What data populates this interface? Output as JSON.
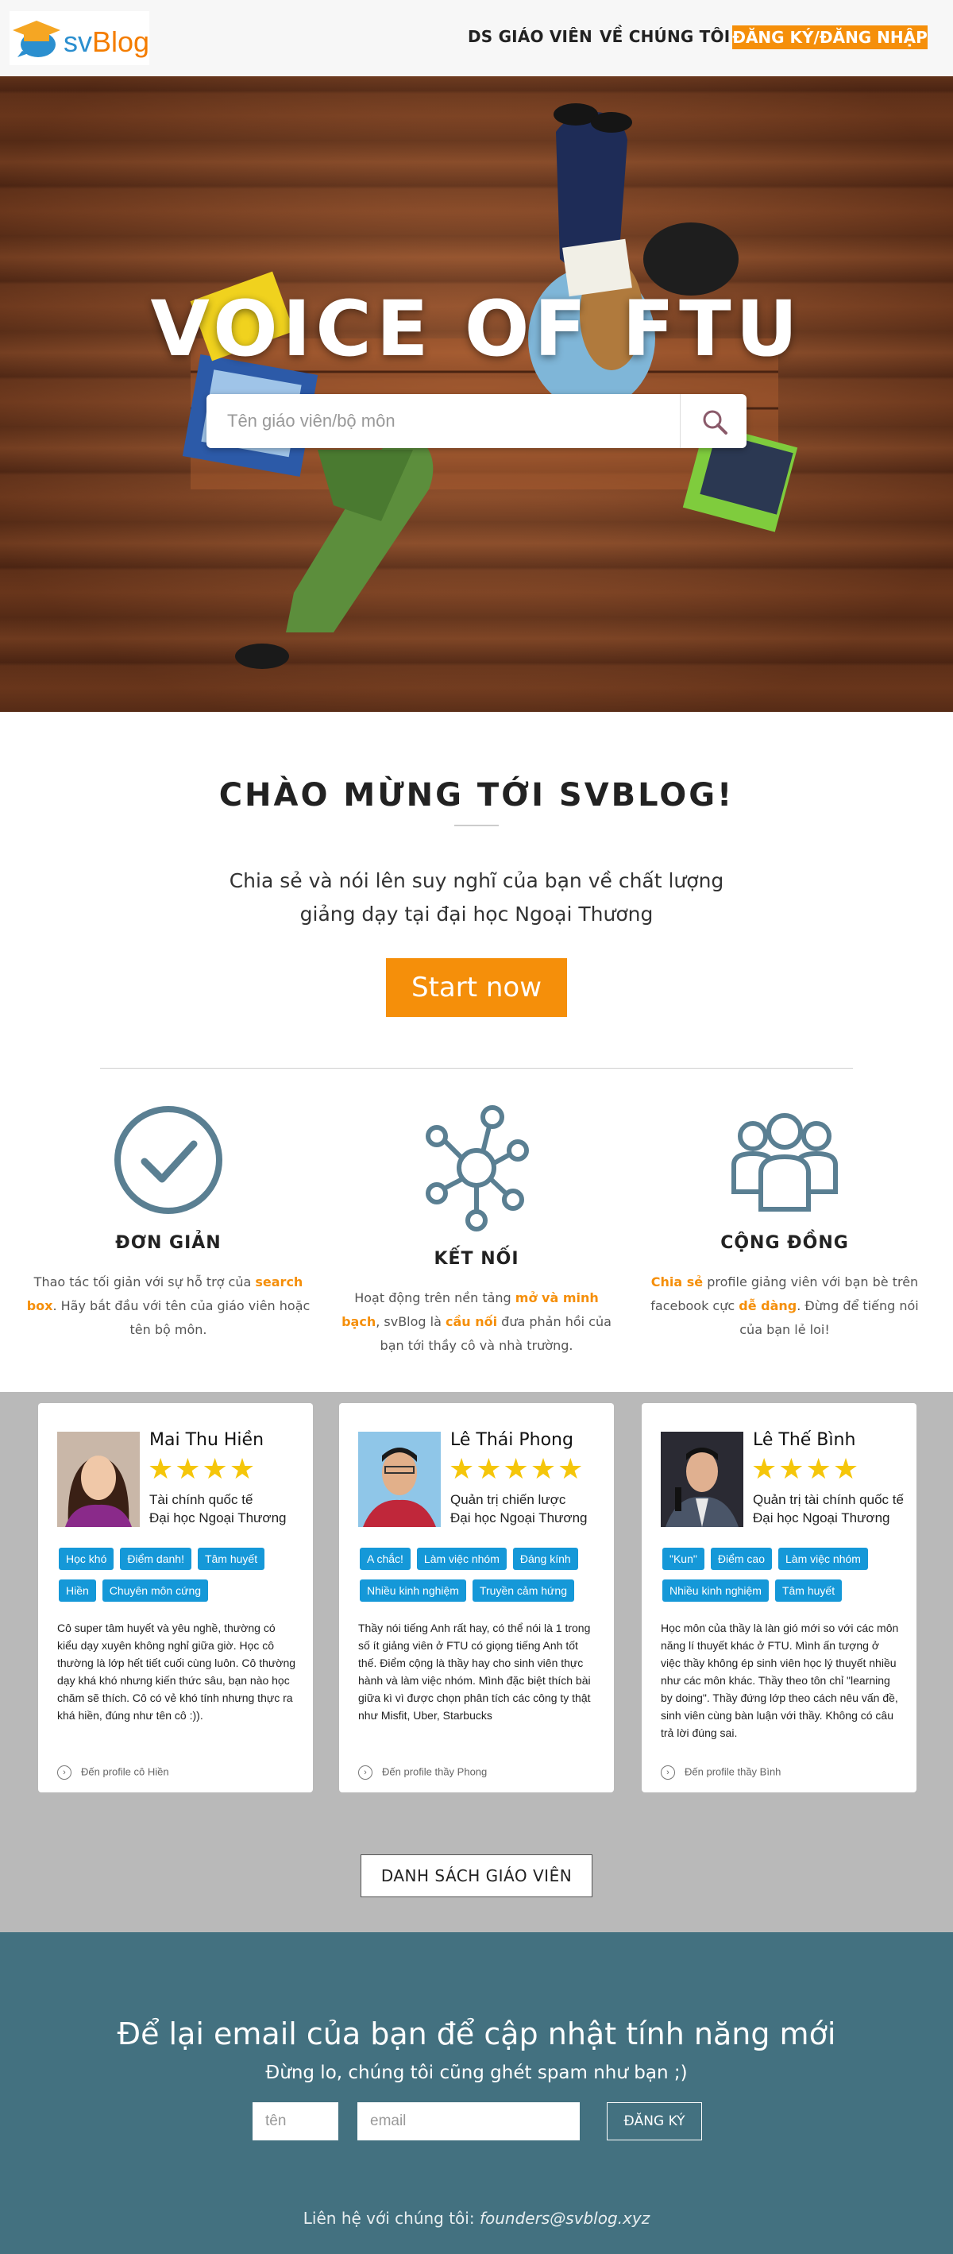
{
  "nav": {
    "logo_text_prefix": "sv",
    "logo_text_suffix": "Blog",
    "links": [
      "DS GIÁO VIÊN",
      "VỀ CHÚNG TÔI"
    ],
    "login": "ĐĂNG KÝ/ĐĂNG NHẬP"
  },
  "hero": {
    "title": "VOICE OF FTU",
    "search_placeholder": "Tên giáo viên/bộ môn"
  },
  "welcome": {
    "title": "CHÀO MỪNG TỚI SVBLOG!",
    "subtitle_line1": "Chia sẻ và nói lên suy nghĩ của bạn về chất lượng",
    "subtitle_line2": "giảng dạy tại đại học Ngoại Thương",
    "cta": "Start now"
  },
  "features": [
    {
      "title": "ĐƠN GIẢN",
      "icon": "check-circle-icon",
      "desc_1": "Thao tác tối giản với sự hỗ trợ của ",
      "desc_hl1": "search box",
      "desc_2": ". Hãy bắt đầu với tên của giáo viên hoặc tên bộ môn."
    },
    {
      "title": "KẾT NỐI",
      "icon": "network-icon",
      "desc_1": "Hoạt động trên nền tảng ",
      "desc_hl1": "mở và minh bạch",
      "desc_2": ", svBlog là ",
      "desc_hl2": "cầu nối",
      "desc_3": " đưa phản hồi của bạn tới thầy cô và nhà trường."
    },
    {
      "title": "CỘNG ĐỒNG",
      "icon": "community-icon",
      "desc_hl1": "Chia sẻ",
      "desc_1": " profile giảng viên với bạn bè trên facebook cực ",
      "desc_hl2": "dễ dàng",
      "desc_2": ". Đừng để tiếng nói của bạn lẻ loi!"
    }
  ],
  "teachers": [
    {
      "name": "Mai Thu Hiền",
      "rating": 4,
      "job_line1": "Tài chính quốc tế",
      "job_line2": "Đại học Ngoại Thương",
      "tags": [
        "Học khó",
        "Điểm danh!",
        "Tâm huyết",
        "Hiền",
        "Chuyên môn cứng"
      ],
      "review": "Cô super tâm huyết và yêu nghề, thường có kiểu dạy xuyên không nghỉ giữa giờ. Học cô thường là lớp hết tiết cuối cùng luôn. Cô thường dạy khá khó nhưng kiến thức sâu, bạn nào học chăm sẽ thích. Cô có vẻ khó tính nhưng thực ra khá hiền, đúng như tên cô :)).",
      "link": "Đến profile cô Hiền"
    },
    {
      "name": "Lê Thái Phong",
      "rating": 5,
      "job_line1": "Quản trị chiến lược",
      "job_line2": "Đại học Ngoại Thương",
      "tags": [
        "A chắc!",
        "Làm việc nhóm",
        "Đáng kính",
        "Nhiều kinh nghiệm",
        "Truyền cảm hứng"
      ],
      "review": "Thầy nói tiếng Anh rất hay, có thể nói là 1 trong số ít giảng viên ở FTU có giọng tiếng Anh tốt thế. Điểm cộng là thầy hay cho sinh viên thực hành và làm việc nhóm. Mình đặc biệt thích bài giữa kì vì được chọn phân tích các công ty thật như Misfit, Uber, Starbucks",
      "link": "Đến profile thầy Phong"
    },
    {
      "name": "Lê Thế Bình",
      "rating": 4,
      "job_line1": "Quản trị tài chính quốc tế",
      "job_line2": "Đại học Ngoại Thương",
      "tags": [
        "\"Kun\"",
        "Điểm cao",
        "Làm việc nhóm",
        "Nhiều kinh nghiệm",
        "Tâm huyết"
      ],
      "review": "Học môn của thầy là làn gió mới so với các môn năng lí thuyết khác ở FTU. Mình ấn tượng ở việc thầy không ép sinh viên học lý thuyết nhiều như các môn khác. Thầy theo tôn chỉ \"learning by doing\". Thầy đứng lớp theo cách nêu vấn đề, sinh viên cùng bàn luận với thầy. Không có câu trả lời đúng sai.",
      "link": "Đến profile thầy Bình"
    }
  ],
  "list_button": "DANH SÁCH GIÁO VIÊN",
  "newsletter": {
    "title": "Để lại email của bạn để cập nhật tính năng mới",
    "subtitle": "Đừng lo, chúng tôi cũng ghét spam như bạn ;)",
    "name_placeholder": "tên",
    "email_placeholder": "email",
    "button": "ĐĂNG KÝ",
    "contact_label": "Liên hệ với chúng tôi: ",
    "contact_email": "founders@svblog.xyz"
  },
  "colors": {
    "accent": "#f58f0a",
    "tag_blue": "#1598d8",
    "footer_teal": "#437180",
    "icon_slate": "#5a7f92",
    "star": "#f5c60a"
  }
}
